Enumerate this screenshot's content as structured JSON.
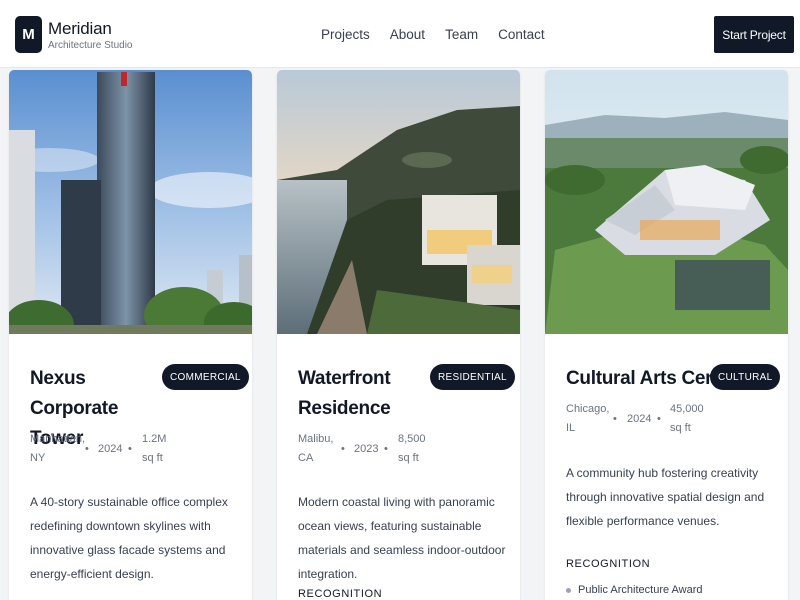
{
  "brand": {
    "mark": "M",
    "name": "Meridian",
    "subtitle": "Architecture Studio"
  },
  "nav": {
    "items": [
      "Projects",
      "About",
      "Team",
      "Contact"
    ]
  },
  "header": {
    "cta_label": "Start Project"
  },
  "projects": [
    {
      "title": "Nexus Corporate Tower",
      "category": "COMMERCIAL",
      "location": "Manhattan, NY",
      "year": "2024",
      "area": "1.2M sq ft",
      "description": "A 40-story sustainable office complex redefining downtown skylines with innovative glass facade systems and energy-efficient design.",
      "image_icon": "office-tower-photo"
    },
    {
      "title": "Waterfront Residence",
      "category": "RESIDENTIAL",
      "location": "Malibu, CA",
      "year": "2023",
      "area": "8,500 sq ft",
      "description": "Modern coastal living with panoramic ocean views, featuring sustainable materials and seamless indoor-outdoor integration.",
      "recognition_label": "RECOGNITION",
      "image_icon": "coastal-house-photo"
    },
    {
      "title": "Cultural Arts Center",
      "category": "CULTURAL",
      "location": "Chicago, IL",
      "year": "2024",
      "area": "45,000 sq ft",
      "description": "A community hub fostering creativity through innovative spatial design and flexible performance venues.",
      "recognition_label": "RECOGNITION",
      "awards": [
        "Public Architecture Award"
      ],
      "image_icon": "arts-center-photo"
    }
  ],
  "colors": {
    "primary": "#111827",
    "background": "#f3f4f6",
    "muted": "#6b7280"
  }
}
